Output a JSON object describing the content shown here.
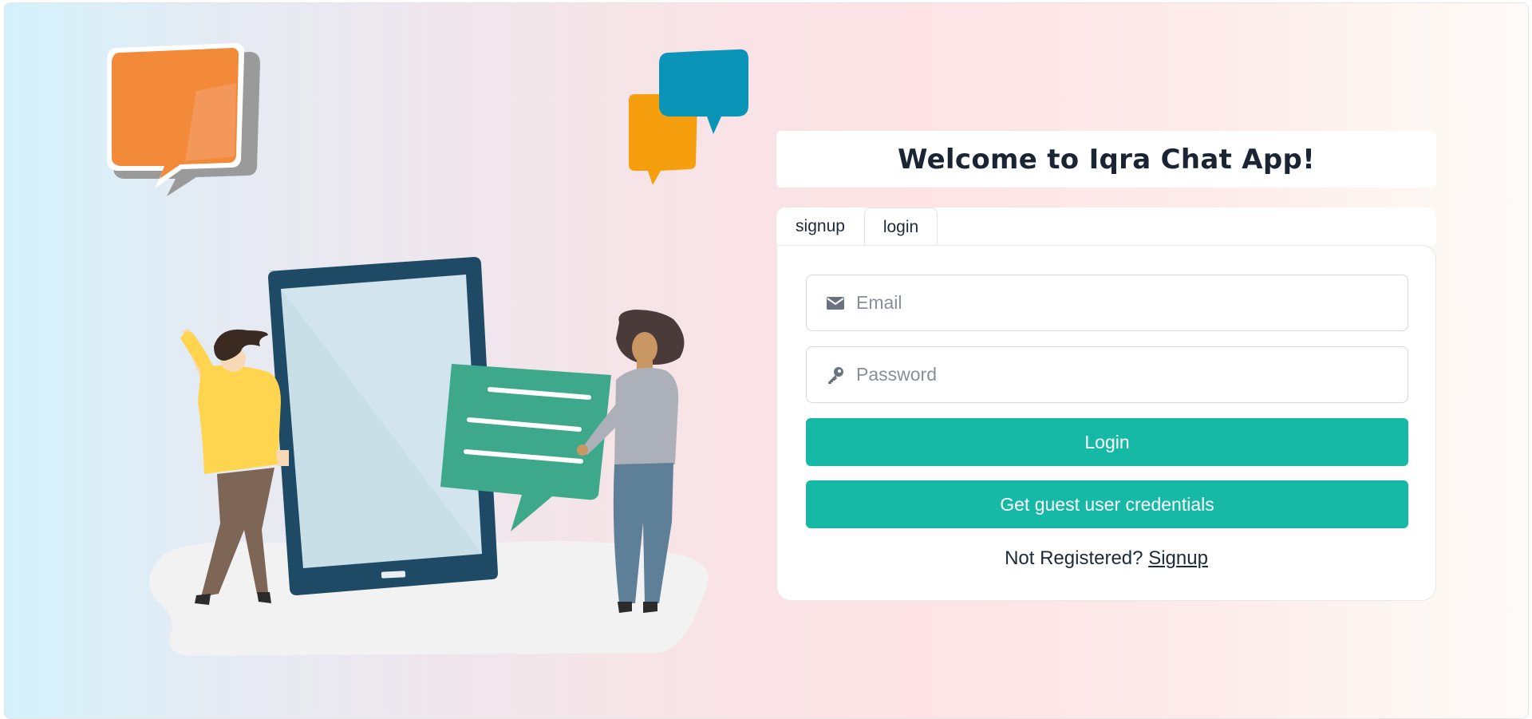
{
  "header": {
    "title": "Welcome to Iqra Chat App!"
  },
  "tabs": [
    {
      "label": "signup",
      "active": false
    },
    {
      "label": "login",
      "active": true
    }
  ],
  "form": {
    "email": {
      "placeholder": "Email",
      "value": "",
      "icon": "envelope-icon"
    },
    "password": {
      "placeholder": "Password",
      "value": "",
      "icon": "key-icon"
    },
    "login_button": "Login",
    "guest_button": "Get guest user credentials",
    "footer_text": "Not Registered?",
    "footer_link": "Signup"
  },
  "colors": {
    "accent": "#16b8a6",
    "title": "#1a2433"
  }
}
